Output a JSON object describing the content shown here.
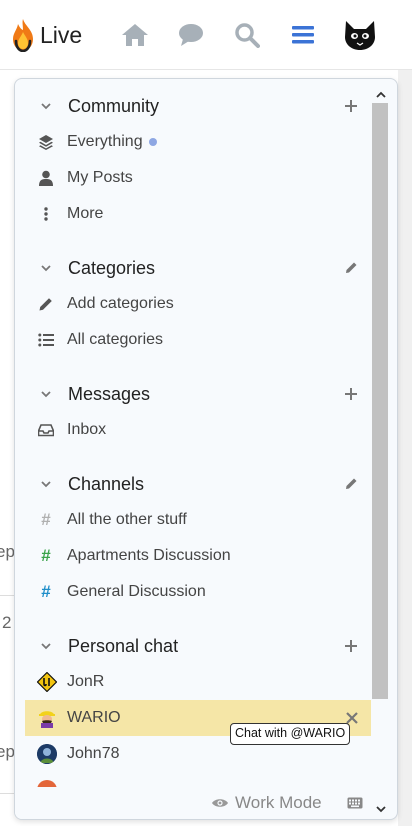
{
  "header": {
    "brand": "Live",
    "icons": [
      "flame-logo",
      "home-icon",
      "chat-icon",
      "search-icon",
      "hamburger-icon",
      "cat-avatar"
    ]
  },
  "background": {
    "fragments": [
      "ep",
      "2",
      "ep"
    ]
  },
  "sidebar": {
    "community": {
      "title": "Community",
      "items": [
        {
          "label": "Everything",
          "icon": "layers-icon",
          "unread": true
        },
        {
          "label": "My Posts",
          "icon": "user-icon"
        },
        {
          "label": "More",
          "icon": "vertical-dots-icon"
        }
      ]
    },
    "categories": {
      "title": "Categories",
      "items": [
        {
          "label": "Add categories",
          "icon": "pencil-icon"
        },
        {
          "label": "All categories",
          "icon": "list-icon"
        }
      ]
    },
    "messages": {
      "title": "Messages",
      "items": [
        {
          "label": "Inbox",
          "icon": "inbox-icon"
        }
      ]
    },
    "channels": {
      "title": "Channels",
      "items": [
        {
          "label": "All the other stuff",
          "hash_color": "#b0b0b0"
        },
        {
          "label": "Apartments Discussion",
          "hash_color": "#3aa34a"
        },
        {
          "label": "General Discussion",
          "hash_color": "#1f8ec9"
        }
      ]
    },
    "personal_chat": {
      "title": "Personal chat",
      "items": [
        {
          "label": "JonR"
        },
        {
          "label": "WARIO",
          "active": true
        },
        {
          "label": "John78"
        }
      ]
    }
  },
  "tooltip": "Chat with @WARIO",
  "footer": {
    "work_mode": "Work Mode"
  },
  "colors": {
    "accent_blue": "#3b73d6",
    "active_row": "#f5e6a7",
    "unread_dot": "#8ea7e3"
  }
}
